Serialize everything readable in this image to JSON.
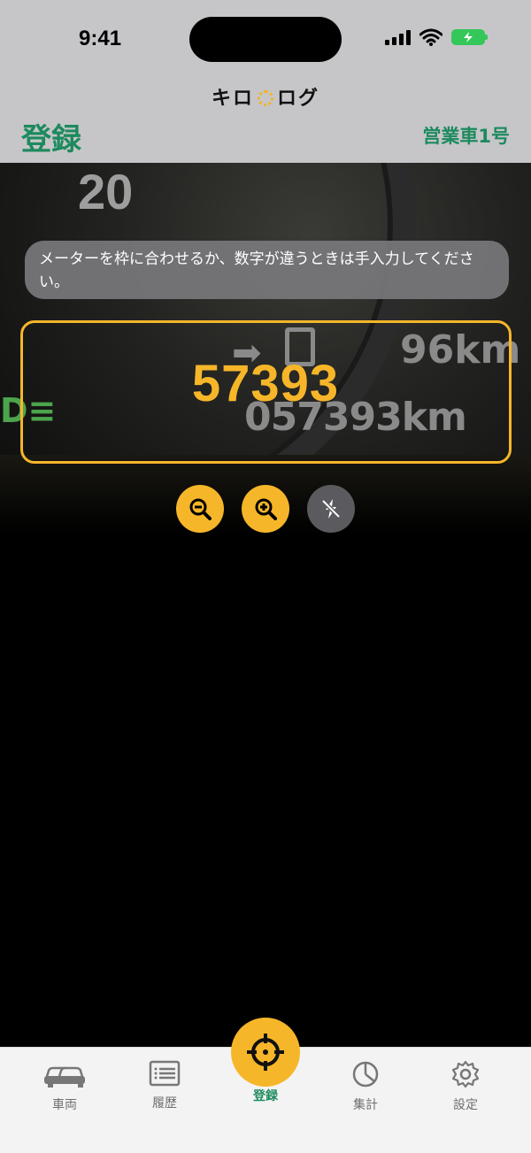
{
  "status_bar": {
    "time": "9:41"
  },
  "header": {
    "app_title_left": "キロ",
    "app_title_right": "ログ",
    "page_title": "登録",
    "vehicle_name": "営業車1号"
  },
  "camera": {
    "hint": "メーターを枠に合わせるか、数字が違うときは手入力してください。",
    "reading": "57393",
    "photo_text": {
      "dial": "20",
      "range": "96km",
      "odometer": "057393km"
    }
  },
  "tabs": [
    {
      "label": "車両",
      "icon": "car-icon"
    },
    {
      "label": "履歴",
      "icon": "list-icon"
    },
    {
      "label": "登録",
      "icon": "crosshair-icon"
    },
    {
      "label": "集計",
      "icon": "pie-chart-icon"
    },
    {
      "label": "設定",
      "icon": "gear-icon"
    }
  ],
  "colors": {
    "accent": "#f6b62a",
    "brand": "#1d8a5e",
    "header_bg": "#c6c6c8"
  }
}
